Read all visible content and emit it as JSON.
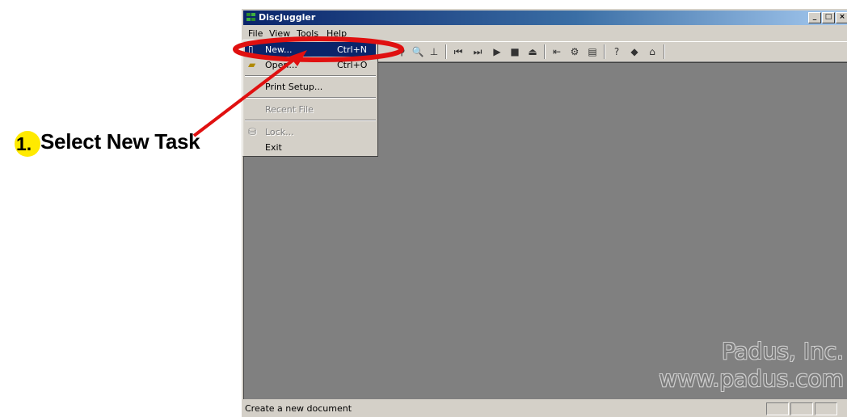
{
  "annotation": {
    "step_number": "1.",
    "step_text": "Select New Task",
    "highlight_color": "#ff0000",
    "badge_color": "#ffea00"
  },
  "window": {
    "title": "DiscJuggler",
    "controls": [
      "_",
      "□",
      "×"
    ],
    "menu": [
      "File",
      "View",
      "Tools",
      "Help"
    ],
    "toolbar_icons": [
      "new-icon",
      "open-icon",
      "search-icon",
      "track-icon",
      "skip-back-icon",
      "skip-forward-icon",
      "play-icon",
      "stop-icon",
      "eject-icon",
      "rewind-icon",
      "tools-icon",
      "drive-icon",
      "help-icon",
      "book-icon",
      "home-icon"
    ],
    "watermark_line1": "Padus, Inc.",
    "watermark_line2": "www.padus.com",
    "status_text": "Create a new document"
  },
  "file_menu": {
    "items": [
      {
        "label": "New...",
        "shortcut": "Ctrl+N",
        "state": "highlighted"
      },
      {
        "label": "Open...",
        "shortcut": "Ctrl+O",
        "state": "enabled"
      },
      {
        "label": "Print Setup...",
        "shortcut": "",
        "state": "enabled"
      },
      {
        "label": "Recent File",
        "shortcut": "",
        "state": "disabled"
      },
      {
        "label": "Lock...",
        "shortcut": "",
        "state": "disabled"
      },
      {
        "label": "Exit",
        "shortcut": "",
        "state": "enabled"
      }
    ]
  }
}
